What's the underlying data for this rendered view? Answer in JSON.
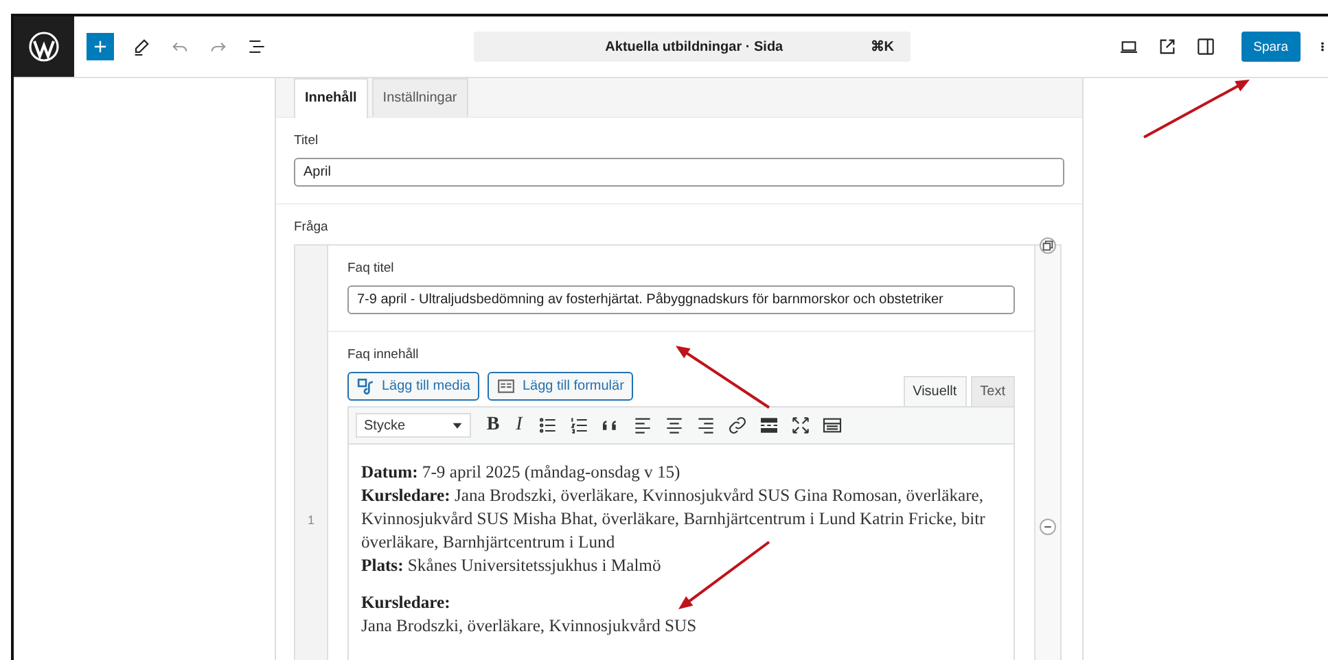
{
  "topbar": {
    "command": {
      "title": "Aktuella utbildningar · Sida",
      "shortcut": "⌘K"
    },
    "save": "Spara"
  },
  "tabs": [
    {
      "label": "Innehåll",
      "selected": true
    },
    {
      "label": "Inställningar",
      "selected": false
    }
  ],
  "title_field": {
    "label": "Titel",
    "value": "April"
  },
  "question": {
    "label": "Fråga",
    "row_number": "1",
    "faq_title": {
      "label": "Faq titel",
      "value": "7-9 april - Ultraljudsbedömning av fosterhjärtat. Påbyggnadskurs för barnmorskor och obstetriker"
    },
    "faq_content": {
      "label": "Faq innehåll",
      "buttons": [
        {
          "kind": "media",
          "label": "Lägg till media"
        },
        {
          "kind": "form",
          "label": "Lägg till formulär"
        }
      ],
      "editor_tabs": [
        {
          "label": "Visuellt",
          "selected": true
        },
        {
          "label": "Text",
          "selected": false
        }
      ],
      "format_select": "Stycke",
      "format_buttons": [
        {
          "kind": "bold",
          "label": "B"
        },
        {
          "kind": "italic",
          "label": "I"
        },
        {
          "kind": "bullet-list"
        },
        {
          "kind": "numbered-list"
        },
        {
          "kind": "quote"
        },
        {
          "kind": "align-left"
        },
        {
          "kind": "align-center"
        },
        {
          "kind": "align-right"
        },
        {
          "kind": "link"
        },
        {
          "kind": "read-more"
        },
        {
          "kind": "fullscreen"
        },
        {
          "kind": "toolbar-toggle"
        }
      ],
      "paragraphs": [
        [
          "**Datum:** 7-9 april 2025 (måndag-onsdag v 15)",
          "**Kursledare:** Jana Brodszki, överläkare, Kvinnosjukvård SUS Gina Romosan, överläkare, Kvinnosjukvård SUS Misha Bhat, överläkare, Barnhjärtcentrum i Lund Katrin Fricke, bitr överläkare, Barnhjärtcentrum i Lund",
          "**Plats:** Skånes Universitetssjukhus i Malmö"
        ],
        [
          "**Kursledare:**",
          "Jana Brodszki, överläkare, Kvinnosjukvård SUS"
        ]
      ]
    }
  }
}
